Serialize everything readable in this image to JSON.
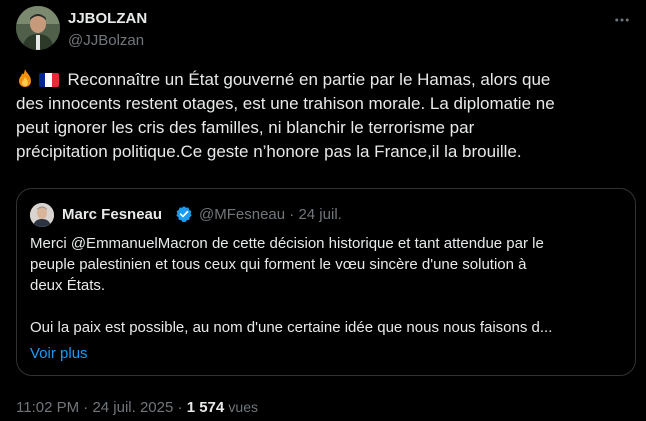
{
  "author": {
    "name": "JJBOLZAN",
    "handle": "@JJBolzan"
  },
  "more_icon": "more-horizontal-icon",
  "tweet": {
    "emojis": [
      "fire-emoji",
      "france-flag-emoji"
    ],
    "line1": "Reconnaître un État gouverné en partie par le Hamas, alors que",
    "line2": "des innocents restent otages, est une trahison morale. La diplomatie ne",
    "line3": "peut ignorer les cris des familles, ni blanchir le terrorisme par",
    "line4": "précipitation politique.Ce geste n’honore pas la France,il la brouille."
  },
  "quote": {
    "name": "Marc Fesneau",
    "verified_icon": "verified-badge-icon",
    "handle": "@MFesneau",
    "separator": "·",
    "date": "24 juil.",
    "line1": "Merci @EmmanuelMacron de cette décision historique et tant attendue par le",
    "line2": "peuple palestinien et tous ceux qui forment le vœu sincère d'une solution à",
    "line3": "deux États.",
    "line4": "Oui la paix est possible, au nom d'une certaine idée que nous nous faisons d...",
    "show_more": "Voir plus"
  },
  "meta": {
    "time": "11:02 PM",
    "separator1": " · ",
    "date": "24 juil. 2025",
    "separator2": " · ",
    "views_count": "1 574",
    "views_label": "vues"
  },
  "colors": {
    "background": "#000000",
    "text": "#e7e9ea",
    "secondary": "#71767b",
    "link": "#1d9bf0",
    "border": "#2f3336",
    "verified": "#1d9bf0"
  }
}
